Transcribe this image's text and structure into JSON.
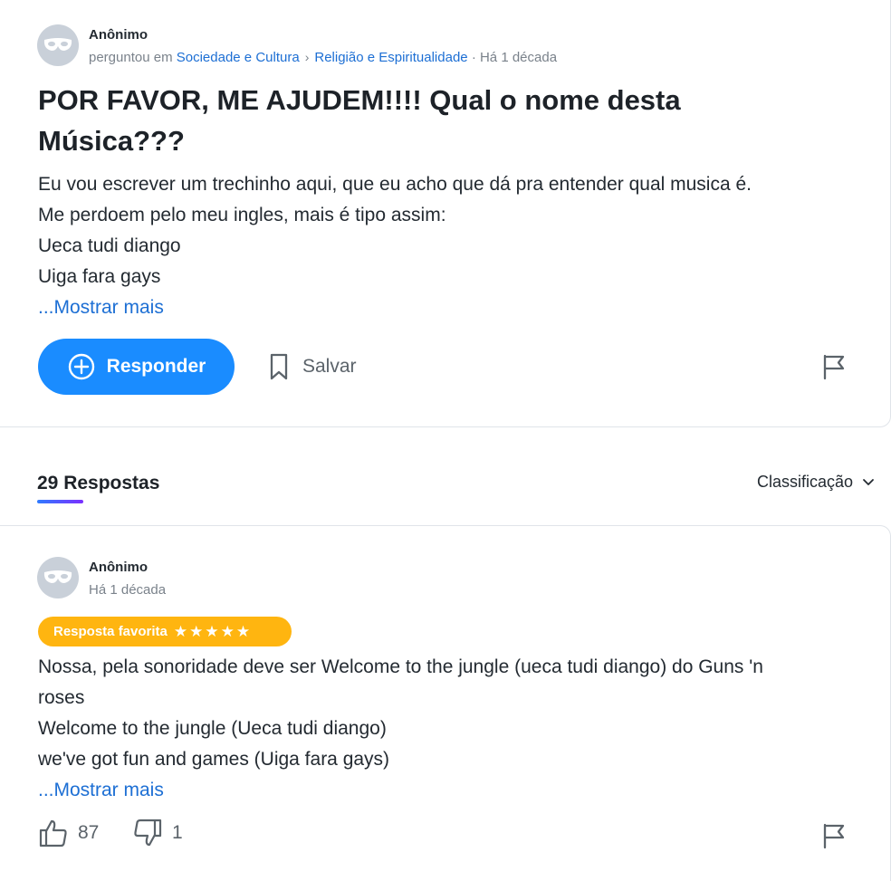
{
  "question": {
    "author": "Anônimo",
    "asked_prefix": "perguntou em",
    "category": "Sociedade e Cultura",
    "subcategory": "Religião e Espiritualidade",
    "time": "· Há 1 década",
    "title_line1": "POR FAVOR, ME AJUDEM!!!! Qual o nome desta",
    "title_line2": "Música???",
    "body": [
      "Eu vou escrever um trechinho aqui, que eu acho que dá pra entender qual musica é.",
      "Me perdoem pelo meu ingles, mais é tipo assim:",
      "Ueca tudi diango",
      "Uiga fara gays"
    ],
    "show_more": "...Mostrar mais",
    "reply_label": "Responder",
    "save_label": "Salvar"
  },
  "answers_header": {
    "count_label": "29 Respostas",
    "sort_label": "Classificação"
  },
  "answer": {
    "author": "Anônimo",
    "time": "Há 1 década",
    "badge_label": "Resposta favorita",
    "badge_stars": "★★★★★",
    "body": [
      "Nossa, pela sonoridade deve ser Welcome to the jungle (ueca tudi diango) do Guns 'n",
      "roses",
      "Welcome to the jungle (Ueca tudi diango)",
      "we've got fun and games (Uiga fara gays)"
    ],
    "show_more": "...Mostrar mais",
    "thumbs_up_count": "87",
    "thumbs_down_count": "1"
  },
  "colors": {
    "accent_blue": "#1a8cff",
    "link_blue": "#1d6fd4",
    "badge_orange": "#ffb510"
  },
  "icons": [
    "anonymous-mask-icon",
    "chevron-right-icon",
    "plus-circle-icon",
    "bookmark-icon",
    "flag-icon",
    "chevron-down-icon",
    "thumbs-up-icon",
    "thumbs-down-icon"
  ]
}
